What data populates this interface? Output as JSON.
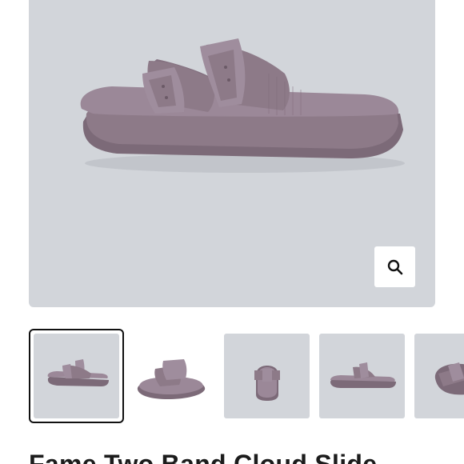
{
  "product": {
    "title": "Fame Two Band Cloud Slide",
    "color": "#8d7a88"
  },
  "gallery": {
    "selected_index": 0,
    "main_image": {
      "icon": "sandal-photo"
    },
    "zoom_button": {
      "icon": "magnifier-icon"
    },
    "thumbnails": [
      {
        "view": "side",
        "selected": true
      },
      {
        "view": "angled-top",
        "selected": false
      },
      {
        "view": "front",
        "selected": false
      },
      {
        "view": "side-profile",
        "selected": false
      },
      {
        "view": "top",
        "selected": false
      }
    ]
  },
  "colors": {
    "image_background": "#d2d5da",
    "sandal": "#8d7a88",
    "selected_border": "#111111"
  }
}
